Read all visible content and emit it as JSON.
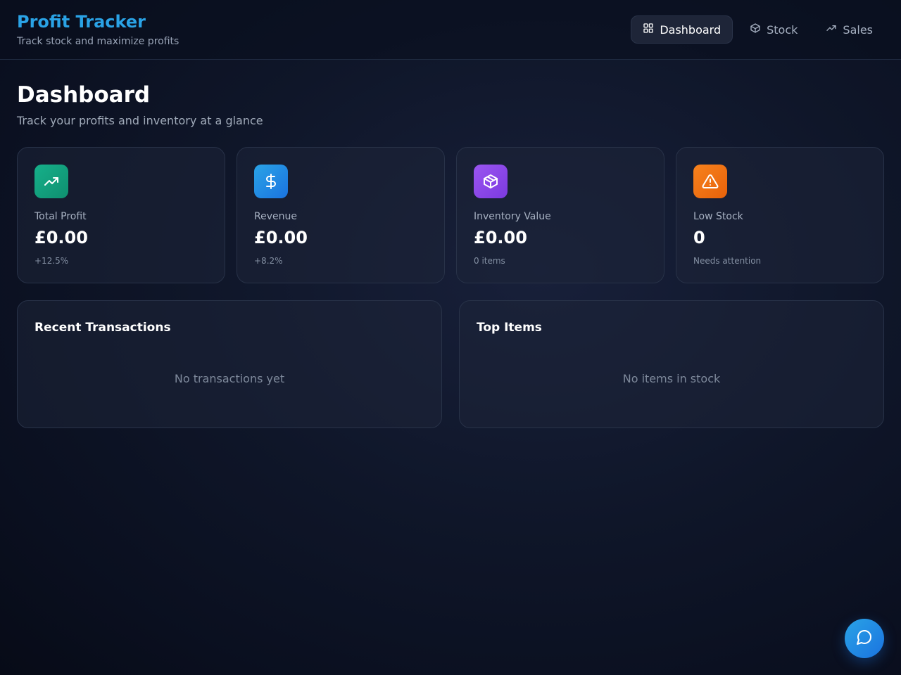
{
  "brand": {
    "title": "Profit Tracker",
    "subtitle": "Track stock and maximize profits",
    "title_color": "#2aa3e6"
  },
  "nav": [
    {
      "label": "Dashboard",
      "icon": "dashboard-grid-icon",
      "active": true
    },
    {
      "label": "Stock",
      "icon": "box-icon",
      "active": false
    },
    {
      "label": "Sales",
      "icon": "trending-up-icon",
      "active": false
    }
  ],
  "page": {
    "title": "Dashboard",
    "subtitle": "Track your profits and inventory at a glance"
  },
  "stats": [
    {
      "label": "Total Profit",
      "value": "£0.00",
      "note": "+12.5%",
      "icon": "trending-up-icon",
      "color": "#14a37f"
    },
    {
      "label": "Revenue",
      "value": "£0.00",
      "note": "+8.2%",
      "icon": "dollar-icon",
      "color": "#1f86e0"
    },
    {
      "label": "Inventory Value",
      "value": "£0.00",
      "note": "0 items",
      "icon": "box-icon",
      "color": "#8b45e6"
    },
    {
      "label": "Low Stock",
      "value": "0",
      "note": "Needs attention",
      "icon": "alert-triangle-icon",
      "color": "#f0700f"
    }
  ],
  "panels": {
    "transactions": {
      "title": "Recent Transactions",
      "empty": "No transactions yet"
    },
    "top_items": {
      "title": "Top Items",
      "empty": "No items in stock"
    }
  },
  "chat": {
    "icon": "chat-bubble-icon"
  }
}
